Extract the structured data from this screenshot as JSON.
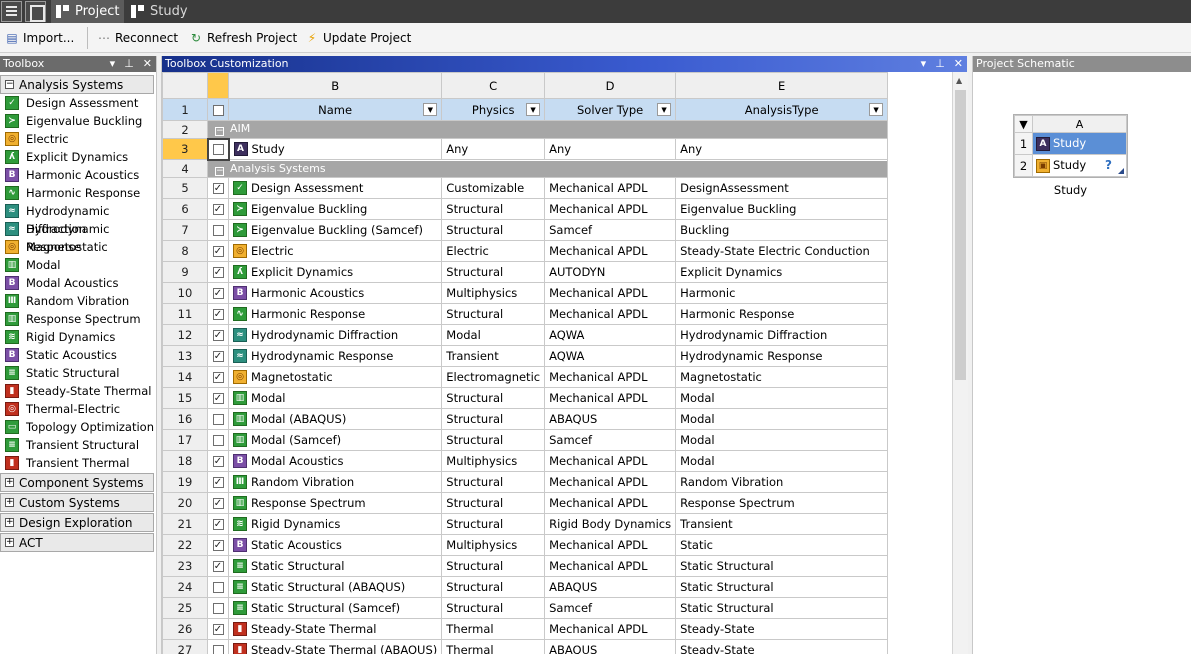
{
  "tabs": {
    "project": "Project",
    "study": "Study"
  },
  "toolbar": {
    "import": "Import...",
    "reconnect": "Reconnect",
    "refresh": "Refresh Project",
    "update": "Update Project"
  },
  "toolbox": {
    "title": "Toolbox",
    "analysis_header": "Analysis Systems",
    "items": [
      {
        "label": "Design Assessment",
        "icon": "check-icon"
      },
      {
        "label": "Eigenvalue Buckling",
        "icon": "buckling-icon"
      },
      {
        "label": "Electric",
        "icon": "electric-icon"
      },
      {
        "label": "Explicit Dynamics",
        "icon": "explicit-icon"
      },
      {
        "label": "Harmonic Acoustics",
        "icon": "acoustics-icon"
      },
      {
        "label": "Harmonic Response",
        "icon": "harmonic-icon"
      },
      {
        "label": "Hydrodynamic Diffraction",
        "icon": "hydro-icon"
      },
      {
        "label": "Hydrodynamic Response",
        "icon": "hydro-icon"
      },
      {
        "label": "Magnetostatic",
        "icon": "magnet-icon"
      },
      {
        "label": "Modal",
        "icon": "modal-icon"
      },
      {
        "label": "Modal Acoustics",
        "icon": "acoustics-icon"
      },
      {
        "label": "Random Vibration",
        "icon": "vibration-icon"
      },
      {
        "label": "Response Spectrum",
        "icon": "spectrum-icon"
      },
      {
        "label": "Rigid Dynamics",
        "icon": "rigid-icon"
      },
      {
        "label": "Static Acoustics",
        "icon": "acoustics-icon"
      },
      {
        "label": "Static Structural",
        "icon": "structural-icon"
      },
      {
        "label": "Steady-State Thermal",
        "icon": "thermal-icon"
      },
      {
        "label": "Thermal-Electric",
        "icon": "thermal-electric-icon"
      },
      {
        "label": "Topology Optimization",
        "icon": "topology-icon"
      },
      {
        "label": "Transient Structural",
        "icon": "structural-icon"
      },
      {
        "label": "Transient Thermal",
        "icon": "thermal-icon"
      }
    ],
    "collapsed": [
      "Component Systems",
      "Custom Systems",
      "Design Exploration",
      "ACT"
    ]
  },
  "customization": {
    "title": "Toolbox Customization",
    "col_letters": [
      "B",
      "C",
      "D",
      "E"
    ],
    "headers": [
      "Name",
      "Physics",
      "Solver Type",
      "AnalysisType"
    ],
    "rows": [
      {
        "n": "2",
        "group": "AIM"
      },
      {
        "n": "3",
        "checked": false,
        "selected": true,
        "icon": "study-icon",
        "name": "Study",
        "physics": "Any",
        "solver": "Any",
        "atype": "Any"
      },
      {
        "n": "4",
        "group": "Analysis Systems"
      },
      {
        "n": "5",
        "checked": true,
        "icon": "check-icon",
        "name": "Design Assessment",
        "physics": "Customizable",
        "solver": "Mechanical APDL",
        "atype": "DesignAssessment"
      },
      {
        "n": "6",
        "checked": true,
        "icon": "buckling-icon",
        "name": "Eigenvalue Buckling",
        "physics": "Structural",
        "solver": "Mechanical APDL",
        "atype": "Eigenvalue Buckling"
      },
      {
        "n": "7",
        "checked": false,
        "icon": "buckling-icon",
        "name": "Eigenvalue Buckling (Samcef)",
        "physics": "Structural",
        "solver": "Samcef",
        "atype": "Buckling"
      },
      {
        "n": "8",
        "checked": true,
        "icon": "electric-icon",
        "name": "Electric",
        "physics": "Electric",
        "solver": "Mechanical APDL",
        "atype": "Steady-State Electric Conduction"
      },
      {
        "n": "9",
        "checked": true,
        "icon": "explicit-icon",
        "name": "Explicit Dynamics",
        "physics": "Structural",
        "solver": "AUTODYN",
        "atype": "Explicit Dynamics"
      },
      {
        "n": "10",
        "checked": true,
        "icon": "acoustics-icon",
        "name": "Harmonic Acoustics",
        "physics": "Multiphysics",
        "solver": "Mechanical APDL",
        "atype": "Harmonic"
      },
      {
        "n": "11",
        "checked": true,
        "icon": "harmonic-icon",
        "name": "Harmonic Response",
        "physics": "Structural",
        "solver": "Mechanical APDL",
        "atype": "Harmonic Response"
      },
      {
        "n": "12",
        "checked": true,
        "icon": "hydro-icon",
        "name": "Hydrodynamic Diffraction",
        "physics": "Modal",
        "solver": "AQWA",
        "atype": "Hydrodynamic Diffraction"
      },
      {
        "n": "13",
        "checked": true,
        "icon": "hydro-icon",
        "name": "Hydrodynamic Response",
        "physics": "Transient",
        "solver": "AQWA",
        "atype": "Hydrodynamic Response"
      },
      {
        "n": "14",
        "checked": true,
        "icon": "magnet-icon",
        "name": "Magnetostatic",
        "physics": "Electromagnetic",
        "solver": "Mechanical APDL",
        "atype": "Magnetostatic"
      },
      {
        "n": "15",
        "checked": true,
        "icon": "modal-icon",
        "name": "Modal",
        "physics": "Structural",
        "solver": "Mechanical APDL",
        "atype": "Modal"
      },
      {
        "n": "16",
        "checked": false,
        "icon": "modal-icon",
        "name": "Modal (ABAQUS)",
        "physics": "Structural",
        "solver": "ABAQUS",
        "atype": "Modal"
      },
      {
        "n": "17",
        "checked": false,
        "icon": "modal-icon",
        "name": "Modal (Samcef)",
        "physics": "Structural",
        "solver": "Samcef",
        "atype": "Modal"
      },
      {
        "n": "18",
        "checked": true,
        "icon": "acoustics-icon",
        "name": "Modal Acoustics",
        "physics": "Multiphysics",
        "solver": "Mechanical APDL",
        "atype": "Modal"
      },
      {
        "n": "19",
        "checked": true,
        "icon": "vibration-icon",
        "name": "Random Vibration",
        "physics": "Structural",
        "solver": "Mechanical APDL",
        "atype": "Random Vibration"
      },
      {
        "n": "20",
        "checked": true,
        "icon": "spectrum-icon",
        "name": "Response Spectrum",
        "physics": "Structural",
        "solver": "Mechanical APDL",
        "atype": "Response Spectrum"
      },
      {
        "n": "21",
        "checked": true,
        "icon": "rigid-icon",
        "name": "Rigid Dynamics",
        "physics": "Structural",
        "solver": "Rigid Body Dynamics",
        "atype": "Transient"
      },
      {
        "n": "22",
        "checked": true,
        "icon": "acoustics-icon",
        "name": "Static Acoustics",
        "physics": "Multiphysics",
        "solver": "Mechanical APDL",
        "atype": "Static"
      },
      {
        "n": "23",
        "checked": true,
        "icon": "structural-icon",
        "name": "Static Structural",
        "physics": "Structural",
        "solver": "Mechanical APDL",
        "atype": "Static Structural"
      },
      {
        "n": "24",
        "checked": false,
        "icon": "structural-icon",
        "name": "Static Structural (ABAQUS)",
        "physics": "Structural",
        "solver": "ABAQUS",
        "atype": "Static Structural"
      },
      {
        "n": "25",
        "checked": false,
        "icon": "structural-icon",
        "name": "Static Structural (Samcef)",
        "physics": "Structural",
        "solver": "Samcef",
        "atype": "Static Structural"
      },
      {
        "n": "26",
        "checked": true,
        "icon": "thermal-icon",
        "name": "Steady-State Thermal",
        "physics": "Thermal",
        "solver": "Mechanical APDL",
        "atype": "Steady-State"
      },
      {
        "n": "27",
        "checked": false,
        "icon": "thermal-icon",
        "name": "Steady-State Thermal (ABAQUS)",
        "physics": "Thermal",
        "solver": "ABAQUS",
        "atype": "Steady-State"
      }
    ]
  },
  "schematic": {
    "title": "Project Schematic",
    "col": "A",
    "rows": [
      {
        "n": "1",
        "label": "Study"
      },
      {
        "n": "2",
        "label": "Study"
      }
    ],
    "caption": "Study"
  }
}
